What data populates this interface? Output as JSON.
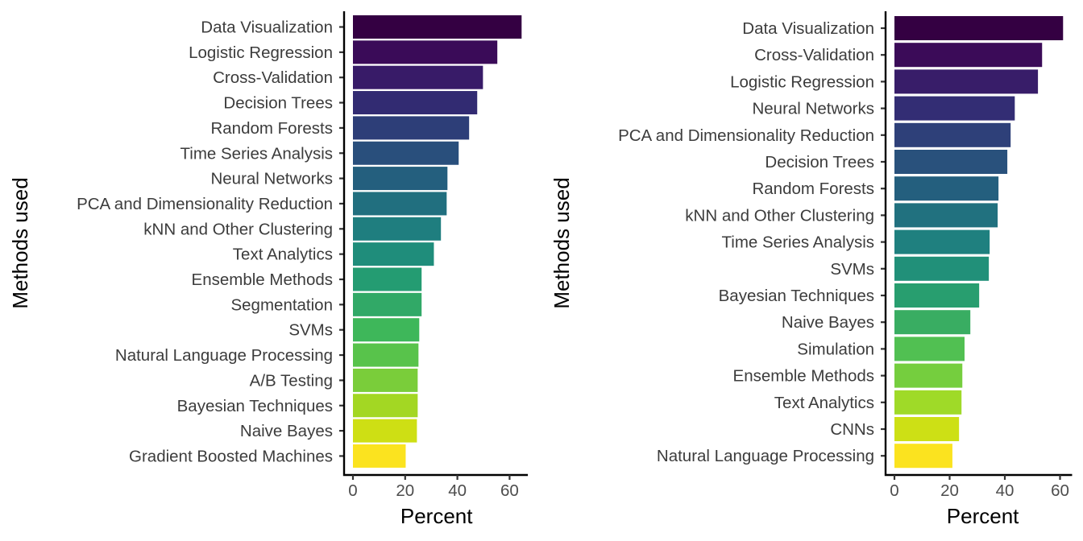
{
  "chart_data": [
    {
      "type": "bar",
      "orientation": "horizontal",
      "title": "",
      "xlabel": "Percent",
      "ylabel": "Methods used",
      "xlim": [
        0,
        67
      ],
      "xticks": [
        0,
        20,
        40,
        60
      ],
      "grid": false,
      "legend": "none",
      "categories": [
        "Data Visualization",
        "Logistic Regression",
        "Cross-Validation",
        "Decision Trees",
        "Random Forests",
        "Time Series Analysis",
        "Neural Networks",
        "PCA and Dimensionality Reduction",
        "kNN and Other Clustering",
        "Text Analytics",
        "Ensemble Methods",
        "Segmentation",
        "SVMs",
        "Natural Language Processing",
        "A/B Testing",
        "Bayesian Techniques",
        "Naive Bayes",
        "Gradient Boosted Machines"
      ],
      "values": [
        64.6,
        55.3,
        49.8,
        47.6,
        44.5,
        40.5,
        36.2,
        35.9,
        33.7,
        31.0,
        26.3,
        26.3,
        25.4,
        25.1,
        24.8,
        24.8,
        24.5,
        20.2
      ],
      "colors": [
        "#340042",
        "#3a0b58",
        "#381b68",
        "#322b72",
        "#2d3e78",
        "#294f7c",
        "#245f7e",
        "#216f7f",
        "#1f7e7f",
        "#1f8d7b",
        "#249c72",
        "#31a967",
        "#3eb75a",
        "#58c34b",
        "#7acd3a",
        "#a3d723",
        "#cedf14",
        "#fbe31f"
      ]
    },
    {
      "type": "bar",
      "orientation": "horizontal",
      "title": "",
      "xlabel": "Percent",
      "ylabel": "Methods used",
      "xlim": [
        0,
        64
      ],
      "xticks": [
        0,
        20,
        40,
        60
      ],
      "grid": false,
      "legend": "none",
      "categories": [
        "Data Visualization",
        "Cross-Validation",
        "Logistic Regression",
        "Neural Networks",
        "PCA and Dimensionality Reduction",
        "Decision Trees",
        "Random Forests",
        "kNN and Other Clustering",
        "Time Series Analysis",
        "SVMs",
        "Bayesian Techniques",
        "Naive Bayes",
        "Simulation",
        "Ensemble Methods",
        "Text Analytics",
        "CNNs",
        "Natural Language Processing"
      ],
      "values": [
        61.1,
        53.5,
        52.0,
        43.6,
        42.1,
        40.9,
        37.7,
        37.4,
        34.5,
        34.2,
        30.7,
        27.5,
        25.4,
        24.6,
        24.3,
        23.4,
        21.0
      ],
      "colors": [
        "#340042",
        "#3b0b58",
        "#381d69",
        "#332d74",
        "#2e4079",
        "#29517c",
        "#245f7e",
        "#21717f",
        "#1f807f",
        "#219079",
        "#289e6f",
        "#39ad62",
        "#51c052",
        "#75ce3e",
        "#9fda28",
        "#cde015",
        "#fbe31f"
      ]
    }
  ]
}
